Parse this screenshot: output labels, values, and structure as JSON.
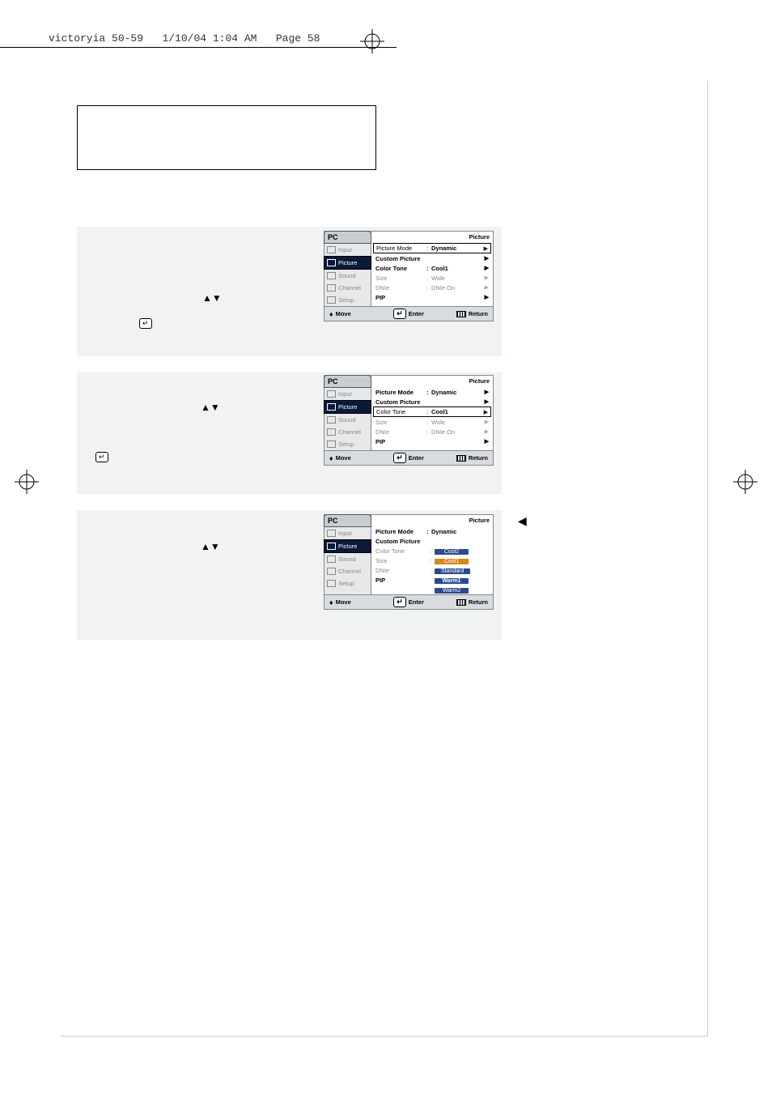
{
  "header": {
    "filename": "victoryia 50-59",
    "datetime": "1/10/04 1:04 AM",
    "page_label": "Page 58"
  },
  "osd_common": {
    "title_tab": "PC",
    "corner": "Picture",
    "nav": {
      "input": "Input",
      "picture": "Picture",
      "sound": "Sound",
      "channel": "Channel",
      "setup": "Setup"
    },
    "footer": {
      "move": "Move",
      "enter": "Enter",
      "return": "Return"
    },
    "opts": {
      "picture_mode": "Picture Mode",
      "custom_picture": "Custom Picture",
      "color_tone": "Color Tone",
      "size": "Size",
      "dnie": "DNIe",
      "pip": "PIP"
    },
    "vals": {
      "dynamic": "Dynamic",
      "cool1": "Cool1",
      "wide": "Wide",
      "dnie_on": "DNIe On"
    },
    "tone_opts": {
      "cool2": "Cool2",
      "cool1": "Cool1",
      "standard": "Standard",
      "warm1": "Warm1",
      "warm2": "Warm2"
    }
  }
}
